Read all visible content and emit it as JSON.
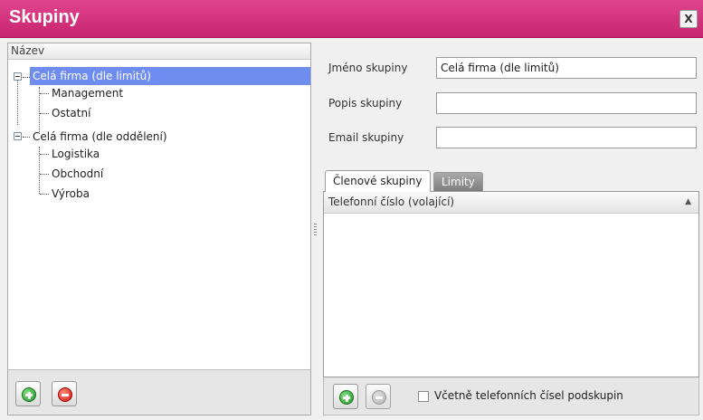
{
  "window": {
    "title": "Skupiny",
    "close_label": "X"
  },
  "tree": {
    "header": "Název",
    "nodes": [
      {
        "label": "Celá firma (dle limitů)",
        "level": 0,
        "selected": true
      },
      {
        "label": "Management",
        "level": 1
      },
      {
        "label": "Ostatní",
        "level": 1
      },
      {
        "label": "Celá firma (dle oddělení)",
        "level": 0
      },
      {
        "label": "Logistika",
        "level": 1
      },
      {
        "label": "Obchodní",
        "level": 1
      },
      {
        "label": "Výroba",
        "level": 1
      }
    ]
  },
  "form": {
    "name_label": "Jméno skupiny",
    "name_value": "Celá firma (dle limitů)",
    "desc_label": "Popis skupiny",
    "desc_value": "",
    "email_label": "Email skupiny",
    "email_value": ""
  },
  "tabs": [
    {
      "label": "Členové skupiny",
      "active": true
    },
    {
      "label": "Limity",
      "active": false
    }
  ],
  "members": {
    "column_header": "Telefonní číslo (volající)",
    "sort_glyph": "▲",
    "include_subgroups_label": "Včetně telefonních čísel podskupin",
    "include_subgroups_checked": false
  },
  "icons": {
    "add": "green-plus-circle",
    "remove": "red-minus-circle",
    "remove_disabled": "grey-minus-circle"
  }
}
